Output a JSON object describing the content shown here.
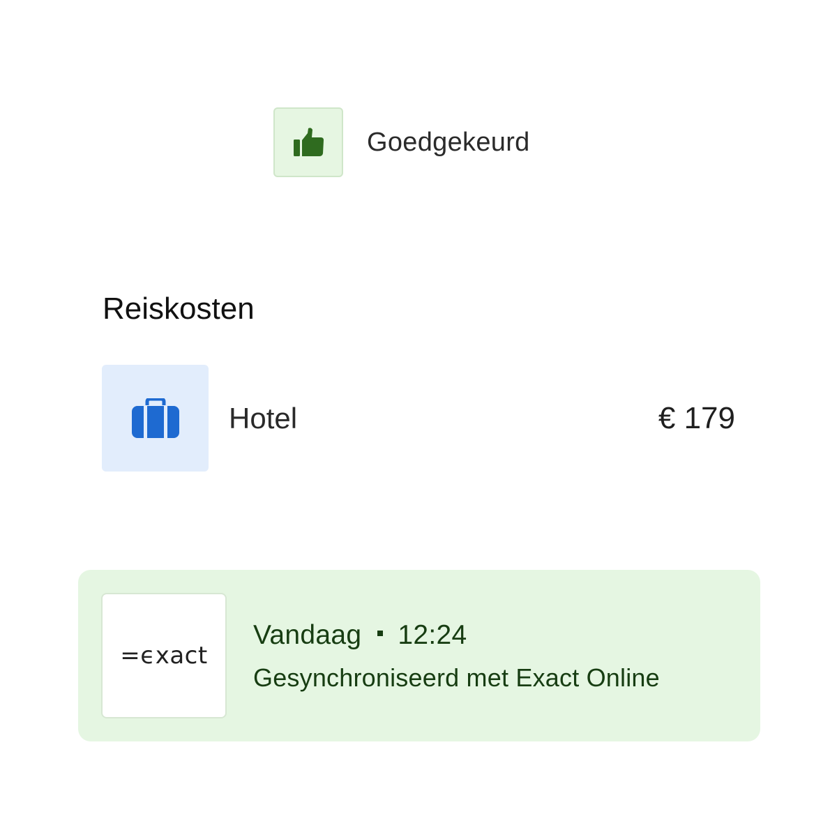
{
  "status": {
    "icon": "thumbs-up-icon",
    "label": "Goedgekeurd",
    "color": "#2f6b1f",
    "background": "#e6f6e2"
  },
  "section": {
    "title": "Reiskosten"
  },
  "expense": {
    "icon": "briefcase-icon",
    "label": "Hotel",
    "amount": "€ 179",
    "icon_color": "#1e6ad1",
    "background": "#e2edfc"
  },
  "sync": {
    "logo_text": "=ϵxact",
    "day": "Vandaag",
    "time": "12:24",
    "description": "Gesynchroniseerd met Exact Online",
    "background": "#e5f6e2",
    "text_color": "#173d12"
  }
}
